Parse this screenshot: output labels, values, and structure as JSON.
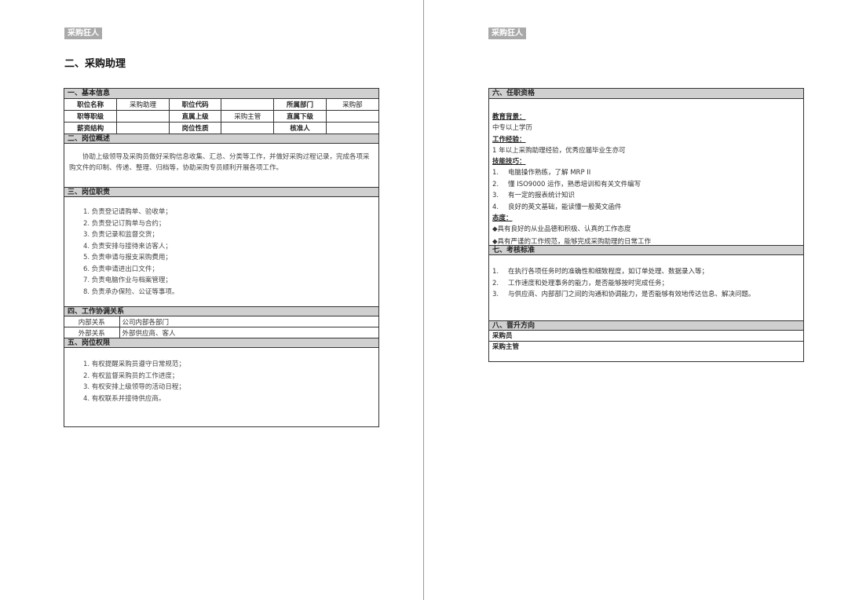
{
  "logo_text": "采购狂人",
  "page_title": "二、采购助理",
  "basic": {
    "header": "一、基本信息",
    "rows": [
      [
        "职位名称",
        "采购助理",
        "职位代码",
        "",
        "所属部门",
        "采购部"
      ],
      [
        "职等职级",
        "",
        "直属上级",
        "采购主管",
        "直属下级",
        ""
      ],
      [
        "薪资结构",
        "",
        "岗位性质",
        "",
        "核准人",
        ""
      ]
    ]
  },
  "overview": {
    "header": "二、岗位概述",
    "text": "协助上级领导及采购员做好采购信息收集、汇总、分类等工作，并做好采购过程记录，完成各项采购文件的印制、传递、整理、归档等，协助采购专员顺利开展各项工作。"
  },
  "duties": {
    "header": "三、岗位职责",
    "items": [
      "1. 负责登记请购单、验收单；",
      "2. 负责登记订购单与合约；",
      "3. 负责记录和监督交货；",
      "4. 负责安排与接待来访客人；",
      "5. 负责申请与报支采购费用；",
      "6. 负责申请进出口文件；",
      "7. 负责电脑作业与档案管理；",
      "8. 负责承办保险、公证等事项。"
    ]
  },
  "relations": {
    "header": "四、工作协调关系",
    "rows": [
      [
        "内部关系",
        "公司内部各部门"
      ],
      [
        "外部关系",
        "外部供应商、客人"
      ]
    ]
  },
  "authority": {
    "header": "五、岗位权限",
    "items": [
      "1. 有权提醒采购员遵守日常规范；",
      "2. 有权监督采购员的工作进度；",
      "3. 有权安排上级领导的活动日程；",
      "4. 有权联系并接待供应商。"
    ]
  },
  "qualifications": {
    "header": "六、任职资格",
    "edu_label": "教育背景：",
    "edu_text": "中专以上学历",
    "exp_label": "工作经验：",
    "exp_text": "1 年以上采购助理经验，优秀应届毕业生亦可",
    "skill_label": "技能技巧：",
    "skills": [
      {
        "num": "1.",
        "text": "电脑操作熟练，了解 MRP II"
      },
      {
        "num": "2.",
        "text": "懂 ISO9000 运作，熟悉培训和有关文件编写"
      },
      {
        "num": "3.",
        "text": "有一定的报表统计知识"
      },
      {
        "num": "4.",
        "text": "良好的英文基础，能读懂一般英文函件"
      }
    ],
    "attitude_label": "态度：",
    "attitudes": [
      "◆具有良好的从业品德和积极、认真的工作态度",
      "◆具有严谨的工作规范，能够完成采购助理的日常工作"
    ]
  },
  "assessment": {
    "header": "七、考核标准",
    "items": [
      {
        "num": "1.",
        "text": "在执行各项任务时的准确性和细致程度，如订单处理、数据录入等；"
      },
      {
        "num": "2.",
        "text": "工作速度和处理事务的能力，是否能够按时完成任务；"
      },
      {
        "num": "3.",
        "text": "与供应商、内部部门之间的沟通和协调能力，是否能够有效地传达信息、解决问题。"
      }
    ]
  },
  "promotion": {
    "header": "八、晋升方向",
    "items": [
      "采购员",
      "采购主管"
    ]
  }
}
